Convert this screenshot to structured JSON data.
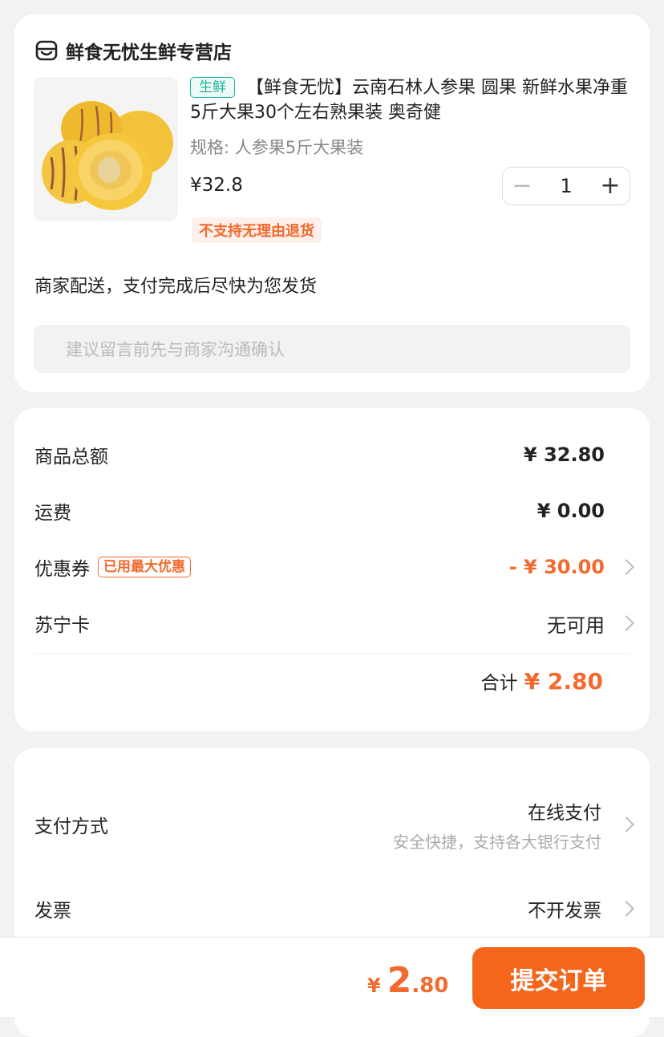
{
  "shop": {
    "name": "鲜食无忧生鲜专营店",
    "product": {
      "tag": "生鲜",
      "title": "【鲜食无忧】云南石林人参果 圆果 新鲜水果净重 5斤大果30个左右熟果装 奥奇健",
      "spec": "规格: 人参果5斤大果装",
      "price": "¥32.8",
      "quantity": "1",
      "return_policy": "不支持无理由退货"
    },
    "delivery": "商家配送，支付完成后尽快为您发货",
    "note_placeholder": "建议留言前先与商家沟通确认"
  },
  "summary": {
    "subtotal_label": "商品总额",
    "subtotal_value": "¥ 32.80",
    "shipping_label": "运费",
    "shipping_value": "¥ 0.00",
    "coupon_label": "优惠券",
    "coupon_tag": "已用最大优惠",
    "coupon_value": "- ¥ 30.00",
    "card_label": "苏宁卡",
    "card_value": "无可用",
    "total_label": "合计",
    "total_value": "¥ 2.80"
  },
  "payment": {
    "method_label": "支付方式",
    "method_value": "在线支付",
    "method_sub": "安全快捷，支持各大银行支付",
    "invoice_label": "发票",
    "invoice_value": "不开发票"
  },
  "footer": {
    "price_yen": "¥",
    "price_int": "2",
    "price_dec": ".80",
    "submit_label": "提交订单"
  },
  "colors": {
    "accent": "#f26a2e",
    "fresh_tag": "#1cb39a"
  }
}
